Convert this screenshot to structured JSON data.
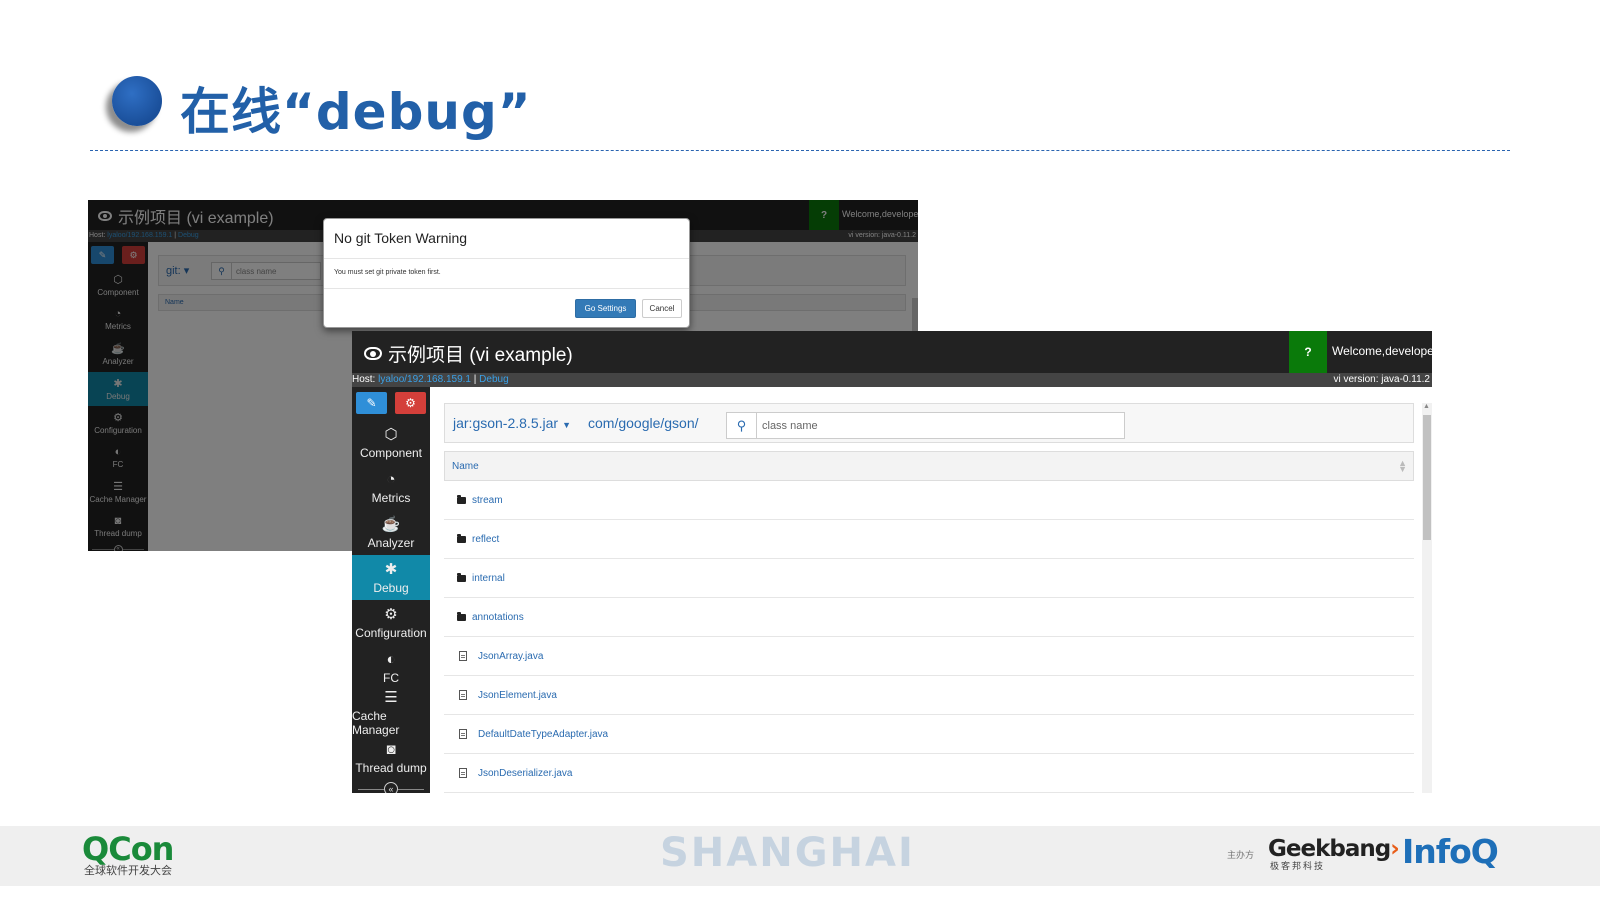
{
  "slide": {
    "title": "在线“debug”",
    "city": "SHANGHAI"
  },
  "app": {
    "project_title": "示例项目 (vi example)",
    "help": "?",
    "welcome": "Welcome,developer",
    "host_label": "Host:",
    "host_value": "lyaloo/192.168.159.1",
    "host_sep": "|",
    "host_link": "Debug",
    "version": "vi version: java-0.11.2",
    "sidebar": [
      {
        "label": "Component",
        "icon": "cube-icon",
        "glyph": "⬡",
        "active": false
      },
      {
        "label": "Metrics",
        "icon": "dashboard-icon",
        "glyph": "◔",
        "active": false
      },
      {
        "label": "Analyzer",
        "icon": "coffee-icon",
        "glyph": "☕",
        "active": false
      },
      {
        "label": "Debug",
        "icon": "bug-icon",
        "glyph": "✱",
        "active": true
      },
      {
        "label": "Configuration",
        "icon": "gears-icon",
        "glyph": "⚙",
        "active": false
      },
      {
        "label": "FC",
        "icon": "toggle-icon",
        "glyph": "◐",
        "active": false
      },
      {
        "label": "Cache Manager",
        "icon": "database-icon",
        "glyph": "☰",
        "active": false
      },
      {
        "label": "Thread dump",
        "icon": "camera-icon",
        "glyph": "◙",
        "active": false
      }
    ],
    "collapse_glyph": "«"
  },
  "back": {
    "git_label": "git:",
    "search_placeholder": "class name",
    "name_header": "Name"
  },
  "modal": {
    "title": "No git Token Warning",
    "body": "You must set git private token first.",
    "primary_button": "Go Settings",
    "cancel_button": "Cancel"
  },
  "front": {
    "jar_prefix": "jar:",
    "jar": "gson-2.8.5.jar",
    "path": "com/google/gson/",
    "search_placeholder": "class name",
    "name_header": "Name",
    "rows": [
      {
        "name": "stream",
        "type": "folder"
      },
      {
        "name": "reflect",
        "type": "folder"
      },
      {
        "name": "internal",
        "type": "folder"
      },
      {
        "name": "annotations",
        "type": "folder"
      },
      {
        "name": "JsonArray.java",
        "type": "file"
      },
      {
        "name": "JsonElement.java",
        "type": "file"
      },
      {
        "name": "DefaultDateTypeAdapter.java",
        "type": "file"
      },
      {
        "name": "JsonDeserializer.java",
        "type": "file"
      }
    ]
  },
  "footer": {
    "qcon": "QCon",
    "qcon_sub": "全球软件开发大会",
    "host_label": "主办方",
    "geekbang": "Geekbang",
    "geekbang_sub": "极客邦科技",
    "infoq": "InfoQ"
  },
  "colors": {
    "title_blue": "#2260a8",
    "topbar": "#222222",
    "help_green": "#0a7a0a",
    "active_teal": "#1189a8",
    "link_blue": "#2a6bb0",
    "primary_btn": "#337ab7",
    "qcon_green": "#1a8a3a",
    "infoq_blue": "#1e6fb8"
  }
}
